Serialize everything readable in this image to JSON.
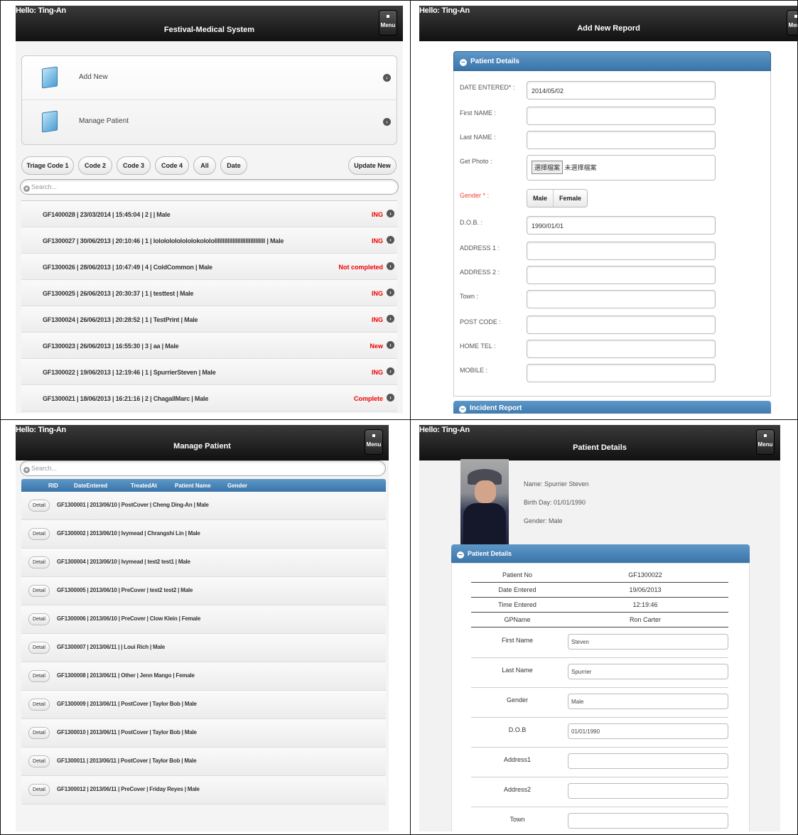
{
  "shared": {
    "hello": "Hello: Ting-An",
    "menu_label": "Menu"
  },
  "p1": {
    "title": "Festival-Medical System",
    "nav": [
      {
        "label": "Add New"
      },
      {
        "label": "Manage Patient"
      }
    ],
    "filters": [
      "Triage Code 1",
      "Code 2",
      "Code 3",
      "Code 4",
      "All",
      "Date"
    ],
    "update_label": "Update New",
    "search_placeholder": "Search...",
    "rows": [
      {
        "text": "GF1400028  |  23/03/2014  |  15:45:04  |  2  |    |  Male",
        "status": "ING"
      },
      {
        "text": "GF1300027  |  30/06/2013  |  20:10:46  |  1  |  lolololololololokolololllllllllllllllllllllllllllllll  |  Male",
        "status": "ING"
      },
      {
        "text": "GF1300026  |  28/06/2013  |  10:47:49  |  4  |  ColdCommon  |  Male",
        "status": "Not completed"
      },
      {
        "text": "GF1300025  |  26/06/2013  |  20:30:37  |  1  |  testtest  |  Male",
        "status": "ING"
      },
      {
        "text": "GF1300024  |  26/06/2013  |  20:28:52  |  1  |  TestPrint  |  Male",
        "status": "ING"
      },
      {
        "text": "GF1300023  |  26/06/2013  |  16:55:30  |  3  |  aa  |  Male",
        "status": "New"
      },
      {
        "text": "GF1300022  |  19/06/2013  |  12:19:46  |  1  |  SpurrierSteven  |  Male",
        "status": "ING"
      },
      {
        "text": "GF1300021  |  18/06/2013  |  16:21:16  |  2  |  ChagallMarc  |  Male",
        "status": "Complete"
      }
    ]
  },
  "p2": {
    "title": "Add New Repord",
    "section_title": "Patient Details",
    "date_label": "DATE ENTERED* :",
    "date_value": "2014/05/02",
    "first_label": "First NAME :",
    "last_label": "Last NAME :",
    "photo_label": "Get Photo :",
    "file_choose": "選擇檔案",
    "file_none": "未選擇檔案",
    "gender_label": "Gender * :",
    "gender_male": "Male",
    "gender_female": "Female",
    "dob_label": "D.O.B. :",
    "dob_value": "1990/01/01",
    "addr1_label": "ADDRESS 1 :",
    "addr2_label": "ADDRESS 2 :",
    "town_label": "Town :",
    "post_label": "POST CODE :",
    "tel_label": "HOME TEL :",
    "mobile_label": "MOBILE :",
    "incident_title": "Incident Report"
  },
  "p3": {
    "title": "Manage Patient",
    "search_placeholder": "Search...",
    "columns": [
      "RID",
      "DateEntered",
      "TreatedAt",
      "Patient Name",
      "Gender"
    ],
    "detail_label": "Detail",
    "rows": [
      "GF1300001  |  2013/06/10  |  PostCover  |  Cheng Ding-An  |  Male",
      "GF1300002  |  2013/06/10  |  Ivymead  |  Chrangshi Lin  |  Male",
      "GF1300004  |  2013/06/10  |  Ivymead  |  test2 test1  |  Male",
      "GF1300005  |  2013/06/10  |  PreCover  |  test2 test2  |  Male",
      "GF1300006  |  2013/06/10  |  PreCover  |  Clow Klein  |  Female",
      "GF1300007  |  2013/06/11  |    |  Loui Rich  |  Male",
      "GF1300008  |  2013/06/11  |  Other  |  Jenn Mango  |  Female",
      "GF1300009  |  2013/06/11  |  PostCover  |  Taylor Bob  |  Male",
      "GF1300010  |  2013/06/11  |  PostCover  |  Taylor Bob  |  Male",
      "GF1300011  |  2013/06/11  |  PostCover  |  Taylor Bob  |  Male",
      "GF1300012  |  2013/06/11  |  PreCover  |  Friday Reyes  |  Male"
    ]
  },
  "p4": {
    "title": "Patient Details",
    "name_line": "Name: Spurrier Steven",
    "birth_line": "Birth Day: 01/01/1990",
    "gender_line": "Gender: Male",
    "section_title": "Patient Details",
    "kv": [
      {
        "k": "Patient No",
        "v": "GF1300022"
      },
      {
        "k": "Date Entered",
        "v": "19/06/2013"
      },
      {
        "k": "Time Entered",
        "v": "12:19:46"
      },
      {
        "k": "GPName",
        "v": "Ron Carter"
      }
    ],
    "fields": [
      {
        "k": "First Name",
        "v": "Steven"
      },
      {
        "k": "Last Name",
        "v": "Spurrier"
      },
      {
        "k": "Gender",
        "v": "Male"
      },
      {
        "k": "D.O.B",
        "v": "01/01/1990"
      },
      {
        "k": "Address1",
        "v": ""
      },
      {
        "k": "Address2",
        "v": ""
      },
      {
        "k": "Town",
        "v": ""
      }
    ]
  }
}
